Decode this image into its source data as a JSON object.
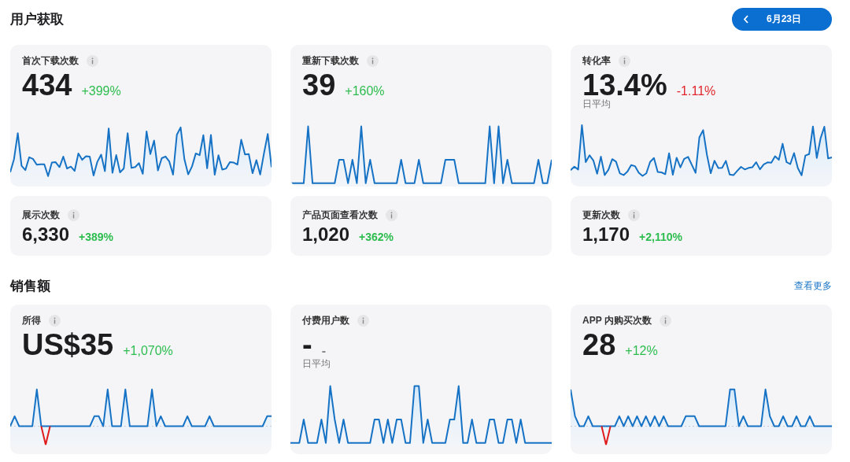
{
  "sections": [
    {
      "title": "用户获取",
      "date_button": {
        "label": "6月23日"
      },
      "cards": [
        {
          "kind": "chart",
          "label": "首次下载次数",
          "value": "434",
          "delta": "+399%",
          "color": "#2dbd4e"
        },
        {
          "kind": "chart",
          "label": "重新下载次数",
          "value": "39",
          "delta": "+160%",
          "color": "#2dbd4e"
        },
        {
          "kind": "chart",
          "label": "转化率",
          "value": "13.4%",
          "delta": "-1.11%",
          "color": "#e0262c",
          "note": "日平均"
        },
        {
          "kind": "compact",
          "label": "展示次数",
          "value": "6,330",
          "delta": "+389%",
          "color": "#2dbd4e"
        },
        {
          "kind": "compact",
          "label": "产品页面查看次数",
          "value": "1,020",
          "delta": "+362%",
          "color": "#2dbd4e"
        },
        {
          "kind": "compact",
          "label": "更新次数",
          "value": "1,170",
          "delta": "+2,110%",
          "color": "#2dbd4e"
        }
      ]
    },
    {
      "title": "销售额",
      "link": "查看更多",
      "cards": [
        {
          "kind": "chart",
          "label": "所得",
          "value": "US$35",
          "delta": "+1,070%",
          "color": "#2dbd4e"
        },
        {
          "kind": "chart",
          "label": "付费用户数",
          "value": "-",
          "delta": "-",
          "color": "#888888",
          "note": "日平均"
        },
        {
          "kind": "chart",
          "label": "APP 内购买次数",
          "value": "28",
          "delta": "+12%",
          "color": "#2dbd4e"
        }
      ]
    }
  ]
}
